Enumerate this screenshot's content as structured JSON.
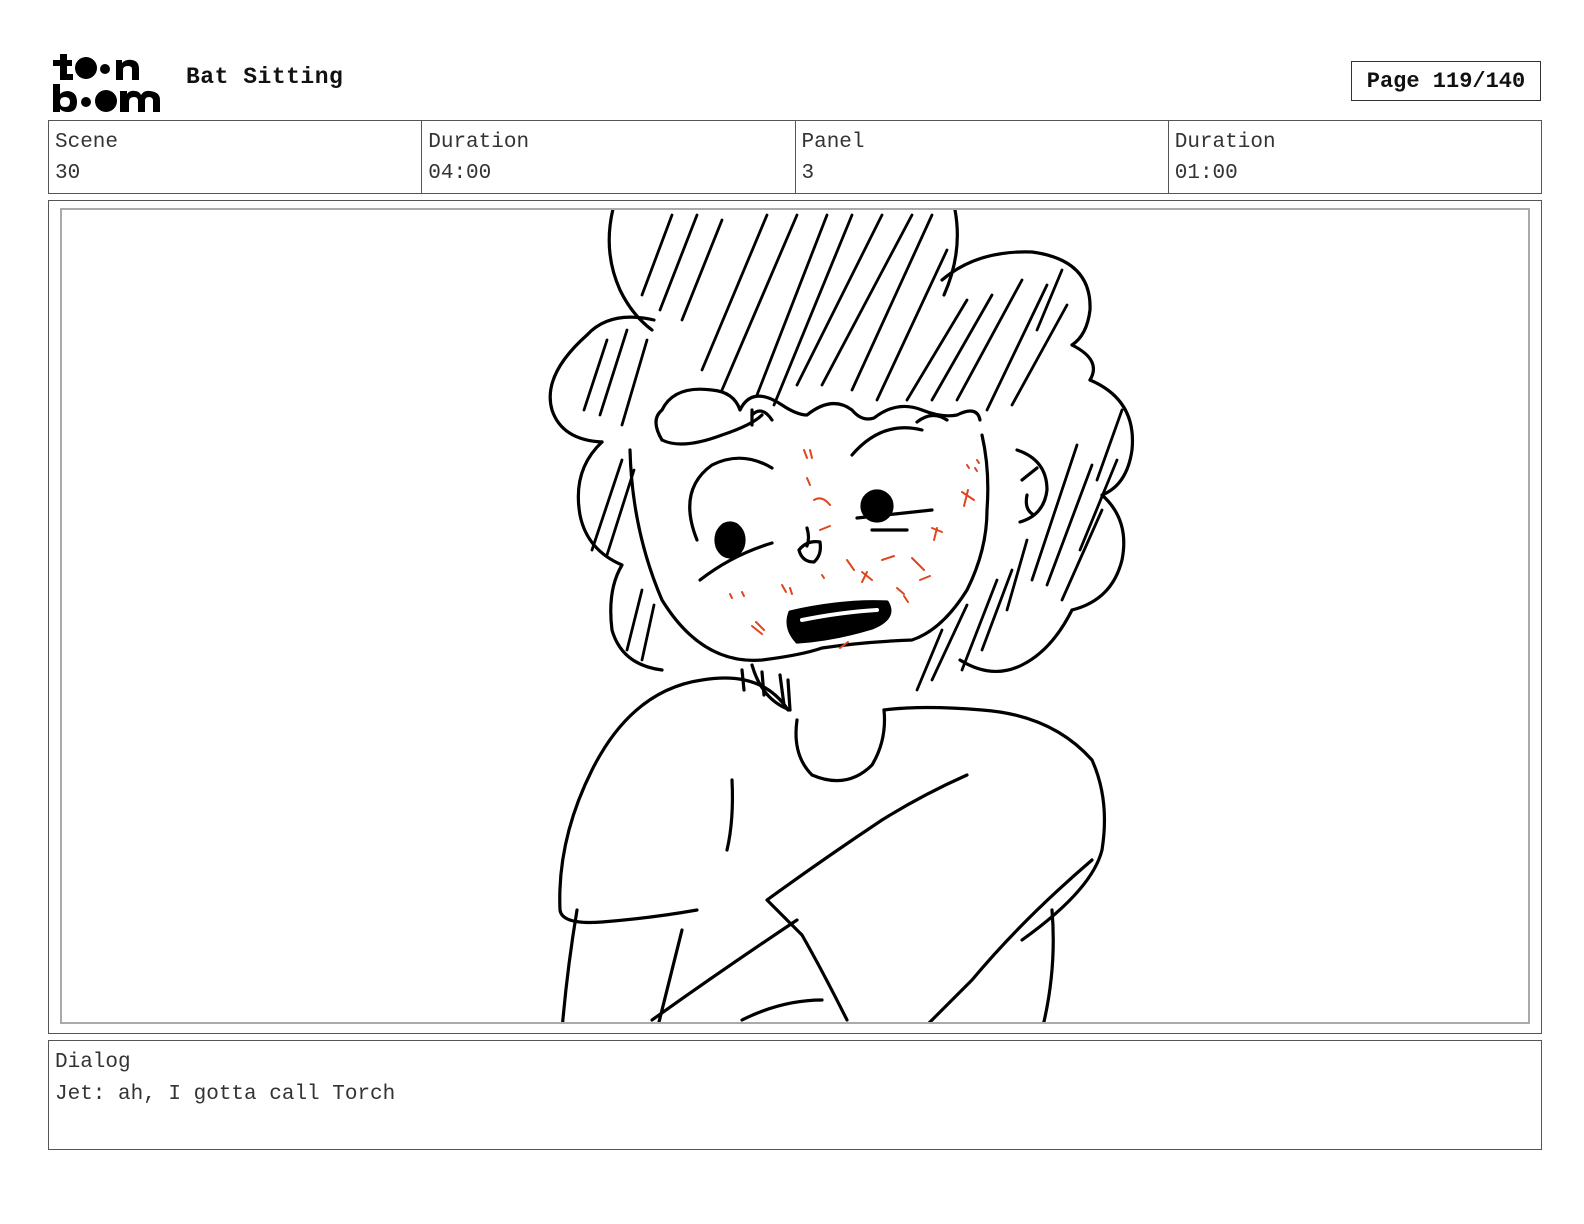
{
  "header": {
    "logo_label": "toon boom",
    "project_title": "Bat Sitting",
    "page_label": "Page 119/140"
  },
  "info": {
    "scene_label": "Scene",
    "scene_value": "30",
    "scene_duration_label": "Duration",
    "scene_duration_value": "04:00",
    "panel_label": "Panel",
    "panel_value": "3",
    "panel_duration_label": "Duration",
    "panel_duration_value": "01:00"
  },
  "dialog": {
    "label": "Dialog",
    "text": "Jet: ah, I gotta call Torch"
  },
  "colors": {
    "line_art": "#000000",
    "blush": "#e0451f",
    "frame": "#555555"
  }
}
